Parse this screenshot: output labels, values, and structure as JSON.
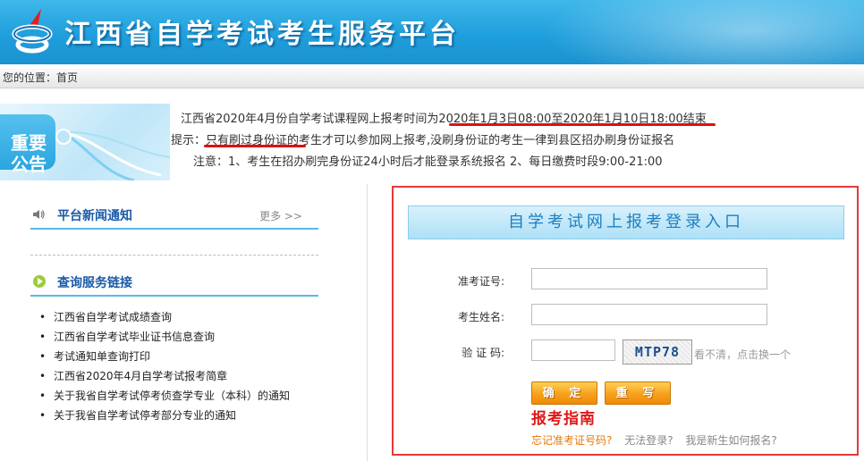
{
  "header": {
    "title": "江西省自学考试考生服务平台"
  },
  "breadcrumb": {
    "prefix": "您的位置：",
    "current": "首页"
  },
  "notice": {
    "badge": "重要公告",
    "line1_prefix": "江西省2020年4月份自学考试课程网上报考时间为",
    "line1_period": "2020年1月3日08:00至2020年1月10日18:00结束",
    "line2_prefix": "提示：",
    "line2_highlight": "只有刷过身份证",
    "line2_rest": "的考生才可以参加网上报考,没刷身份证的考生一律到县区招办刷身份证报名",
    "line3": "注意：1、考生在招办刷完身份证24小时后才能登录系统报名   2、每日缴费时段9:00-21:00"
  },
  "news": {
    "title": "平台新闻通知",
    "more": "更多 >>"
  },
  "query": {
    "title": "查询服务链接",
    "links": [
      "江西省自学考试成绩查询",
      "江西省自学考试毕业证书信息查询",
      "考试通知单查询打印",
      "江西省2020年4月自学考试报考简章",
      "关于我省自学考试停考侦查学专业（本科）的通知",
      "关于我省自学考试停考部分专业的通知"
    ]
  },
  "login": {
    "title": "自学考试网上报考登录入口",
    "exam_no_label": "准考证号:",
    "name_label": "考生姓名:",
    "captcha_label": "验 证 码:",
    "exam_no_value": "",
    "name_value": "",
    "captcha_value": "",
    "captcha_text": "MTP78",
    "captcha_hint": "看不清，点击换一个",
    "confirm_button": "确 定",
    "reset_button": "重 写",
    "guide": "报考指南",
    "forgot_link": "忘记准考证号码?",
    "cannot_login_link": "无法登录?",
    "new_student_link": "我是新生如何报名?"
  },
  "colors": {
    "header_blue": "#1f9fdc",
    "accent_red": "#e01818",
    "button_orange": "#f7a01b",
    "link_orange": "#e07a10",
    "link_gray": "#888888"
  }
}
